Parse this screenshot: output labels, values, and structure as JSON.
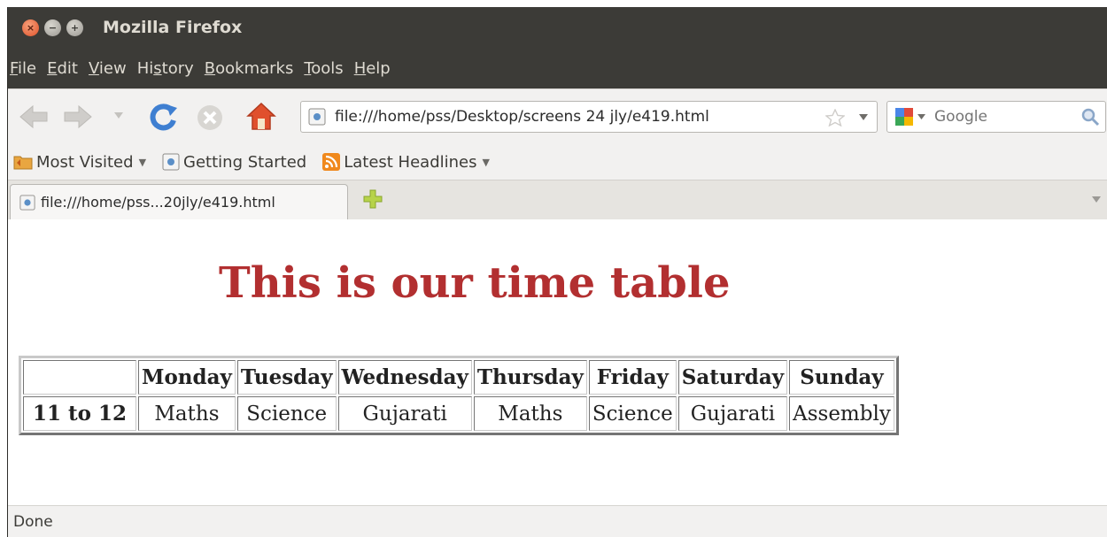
{
  "window": {
    "title": "Mozilla Firefox",
    "buttons": {
      "close": "×",
      "minimize": "−",
      "maximize": "+"
    }
  },
  "menubar": {
    "items": [
      {
        "mnemonic": "F",
        "rest": "ile"
      },
      {
        "mnemonic": "E",
        "rest": "dit"
      },
      {
        "mnemonic": "V",
        "rest": "iew"
      },
      {
        "pre": "Hi",
        "mnemonic": "s",
        "rest": "tory"
      },
      {
        "mnemonic": "B",
        "rest": "ookmarks"
      },
      {
        "mnemonic": "T",
        "rest": "ools"
      },
      {
        "mnemonic": "H",
        "rest": "elp"
      }
    ]
  },
  "navbar": {
    "url": "file:///home/pss/Desktop/screens 24 jly/e419.html",
    "search_placeholder": "Google",
    "icons": [
      "back-arrow-icon",
      "forward-arrow-icon",
      "reload-icon",
      "stop-icon",
      "home-icon",
      "star-icon",
      "google-icon",
      "magnifier-icon"
    ]
  },
  "bookmarks": {
    "items": [
      {
        "label": "Most Visited",
        "has_menu": true,
        "icon": "folder-icon"
      },
      {
        "label": "Getting Started",
        "has_menu": false,
        "icon": "page-icon"
      },
      {
        "label": "Latest Headlines",
        "has_menu": true,
        "icon": "rss-icon"
      }
    ]
  },
  "tabs": {
    "items": [
      {
        "title": "file:///home/pss...20jly/e419.html",
        "active": true
      }
    ]
  },
  "page": {
    "heading": "This is our time table",
    "table": {
      "corner": "",
      "columns": [
        "Monday",
        "Tuesday",
        "Wednesday",
        "Thursday",
        "Friday",
        "Saturday",
        "Sunday"
      ],
      "rows": [
        {
          "label": "11 to 12",
          "cells": [
            "Maths",
            "Science",
            "Gujarati",
            "Maths",
            "Science",
            "Gujarati",
            "Assembly"
          ]
        }
      ]
    }
  },
  "status": {
    "text": "Done"
  },
  "colors": {
    "titlebar": "#3c3b37",
    "heading": "#b22f30",
    "toolbar": "#f2f1f0"
  }
}
